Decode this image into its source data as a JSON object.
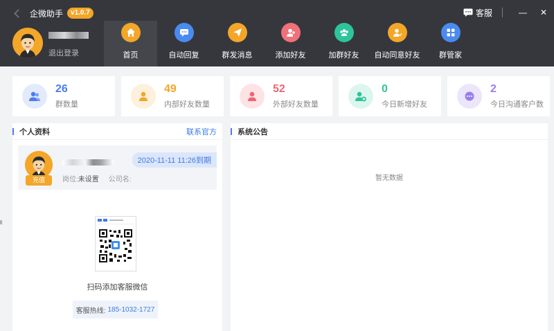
{
  "app": {
    "title": "企微助手",
    "version": "v1.0.7"
  },
  "user": {
    "logout_label": "退出登录"
  },
  "window": {
    "service_label": "客服",
    "minimize": "—",
    "close": "✕"
  },
  "nav": [
    {
      "label": "首页",
      "icon": "home-icon",
      "color": "#f3a628"
    },
    {
      "label": "自动回复",
      "icon": "chat-bubble-icon",
      "color": "#4a8bf0"
    },
    {
      "label": "群发消息",
      "icon": "send-icon",
      "color": "#f3a628"
    },
    {
      "label": "添加好友",
      "icon": "add-user-icon",
      "color": "#f0717a"
    },
    {
      "label": "加群好友",
      "icon": "group-icon",
      "color": "#2dc49c"
    },
    {
      "label": "自动同意好友",
      "icon": "auto-agree-icon",
      "color": "#f3a628"
    },
    {
      "label": "群管家",
      "icon": "grid-icon",
      "color": "#4a8bf0"
    }
  ],
  "stats": [
    {
      "value": "26",
      "label": "群数量",
      "color": "#4a7cf0",
      "bg": "#e3eafc",
      "icon": "group-icon"
    },
    {
      "value": "49",
      "label": "内部好友数量",
      "color": "#f3a628",
      "bg": "#fdf0dc",
      "icon": "user-icon"
    },
    {
      "value": "52",
      "label": "外部好友数量",
      "color": "#f06570",
      "bg": "#fde3e5",
      "icon": "user-icon"
    },
    {
      "value": "0",
      "label": "今日新增好友",
      "color": "#2dc49c",
      "bg": "#dcf6ee",
      "icon": "add-user-icon"
    },
    {
      "value": "2",
      "label": "今日沟通客户数",
      "color": "#9b7ee8",
      "bg": "#ece6fb",
      "icon": "chat-icon"
    }
  ],
  "profile": {
    "title": "个人资料",
    "contact_label": "联系官方",
    "recharge_label": "充值",
    "expiry": "2020-11-11 11:26到期",
    "position_label": "岗位:",
    "position_value": "未设置",
    "company_label": "公司名:",
    "qr_caption": "扫码添加客服微信",
    "hotline_label": "客服热线:",
    "hotline_number": "185-1032-1727"
  },
  "notice": {
    "title": "系统公告",
    "empty_text": "暂无数据"
  }
}
